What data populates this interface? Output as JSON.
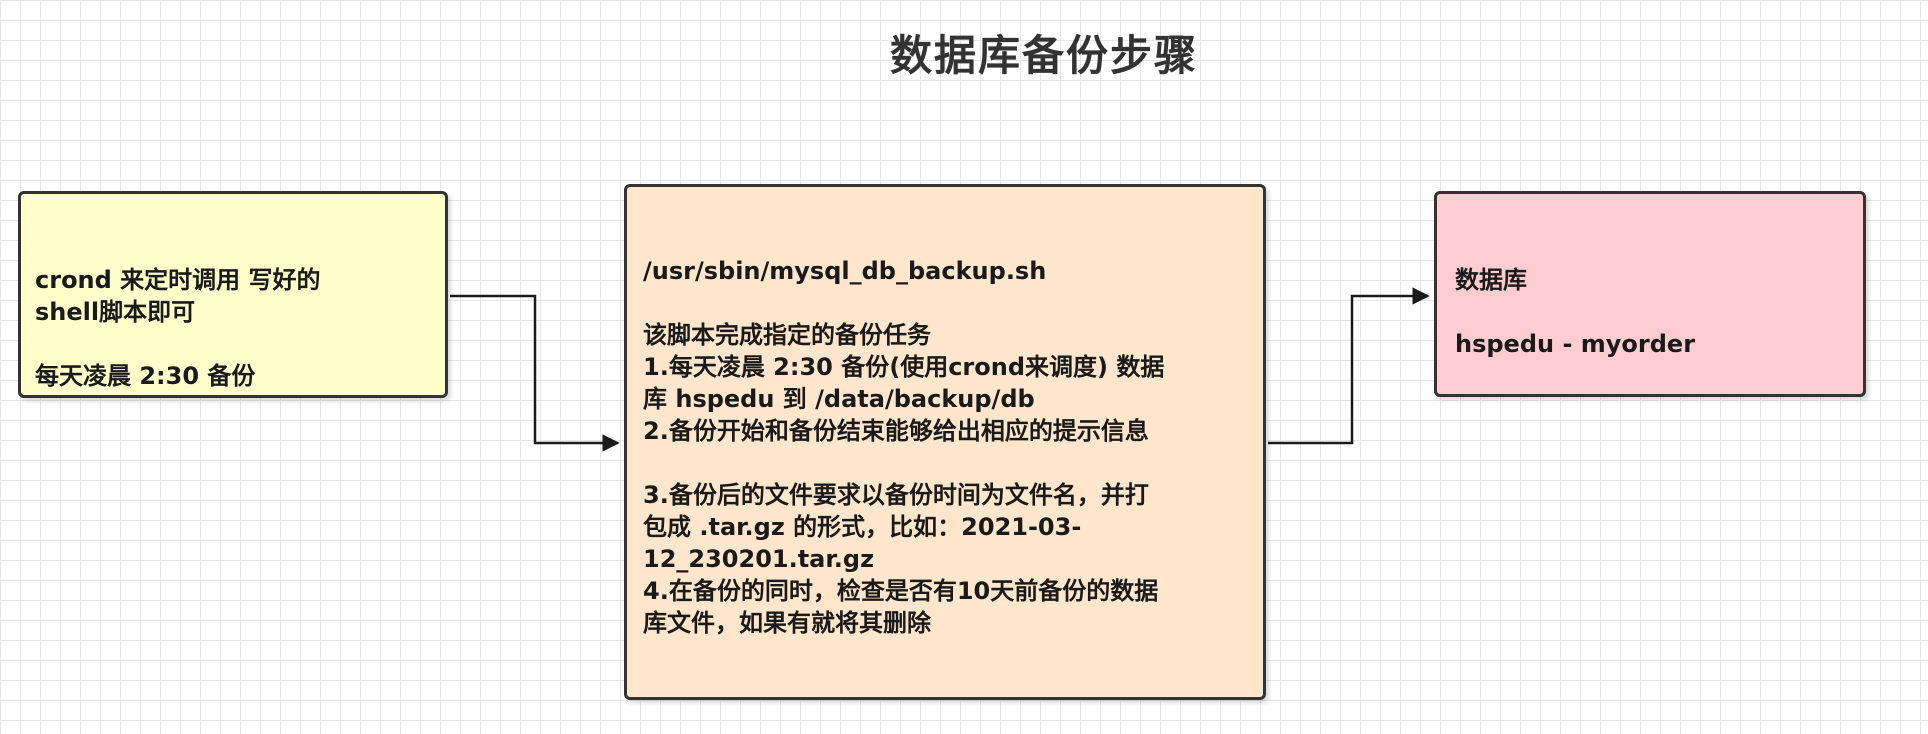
{
  "title": "数据库备份步骤",
  "nodes": {
    "trigger": {
      "text": "crond 来定时调用 写好的\nshell脚本即可\n\n每天凌晨 2:30 备份"
    },
    "script": {
      "text": "/usr/sbin/mysql_db_backup.sh\n\n该脚本完成指定的备份任务\n1.每天凌晨 2:30 备份(使用crond来调度) 数据\n库 hspedu 到 /data/backup/db\n2.备份开始和备份结束能够给出相应的提示信息\n\n3.备份后的文件要求以备份时间为文件名，并打\n包成 .tar.gz 的形式，比如：2021-03-\n12_230201.tar.gz\n4.在备份的同时，检查是否有10天前备份的数据\n库文件，如果有就将其删除"
    },
    "database": {
      "text": "数据库\n\nhspedu - myorder"
    }
  },
  "colors": {
    "trigger_fill": "#ffffcc",
    "script_fill": "#ffe6cc",
    "database_fill": "#ffccd2",
    "stroke": "#333333"
  }
}
